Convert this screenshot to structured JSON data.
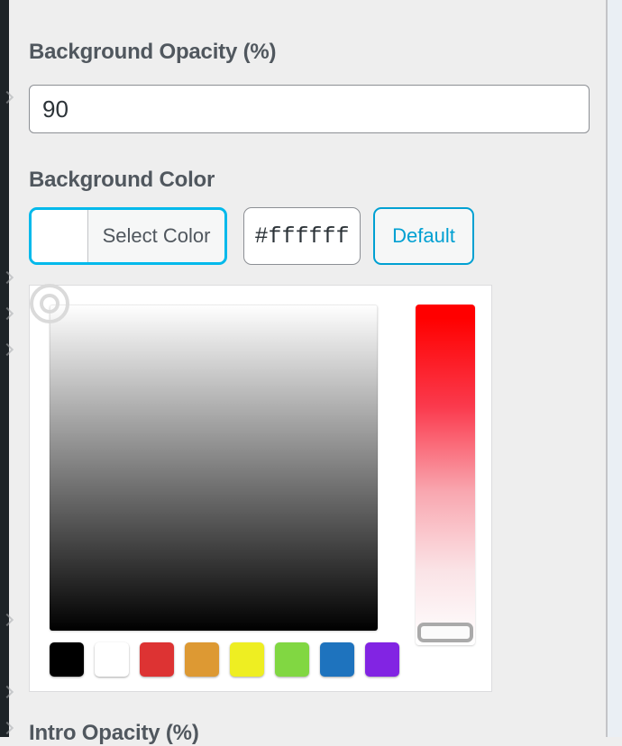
{
  "window": {
    "background": "#eeeeee",
    "rail_color": "#1d2327",
    "accent": "#00a0d2",
    "focus_ring": "#00b9eb"
  },
  "fields": {
    "background_opacity": {
      "label": "Background Opacity (%)",
      "value": "90",
      "placeholder": ""
    },
    "background_color": {
      "label": "Background Color",
      "select_color_label": "Select Color",
      "current_swatch": "#ffffff",
      "hex_value": "#ffffff",
      "hex_placeholder": "#ffffff",
      "default_label": "Default"
    },
    "intro_opacity": {
      "label": "Intro Opacity (%)"
    }
  },
  "color_picker": {
    "square_gradient_from": "#ffffff",
    "square_gradient_to": "#000000",
    "strip_gradient_from": "#ff0000",
    "strip_gradient_to": "#ffffff",
    "handle_position": "top-left",
    "strip_handle_position": "bottom",
    "palette": [
      {
        "name": "swatch-black",
        "hex": "#000000"
      },
      {
        "name": "swatch-white",
        "hex": "#ffffff"
      },
      {
        "name": "swatch-red",
        "hex": "#dd3333"
      },
      {
        "name": "swatch-orange",
        "hex": "#dd9933"
      },
      {
        "name": "swatch-yellow",
        "hex": "#eeee22"
      },
      {
        "name": "swatch-green",
        "hex": "#81d742"
      },
      {
        "name": "swatch-blue",
        "hex": "#1e73be"
      },
      {
        "name": "swatch-purple",
        "hex": "#8224e3"
      }
    ]
  },
  "rail": {
    "chevron_positions": [
      100,
      300,
      340,
      380,
      680,
      760,
      800
    ]
  }
}
